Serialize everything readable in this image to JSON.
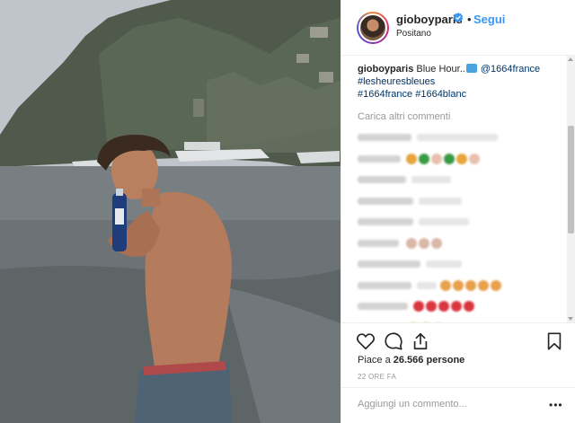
{
  "post": {
    "username": "gioboyparis",
    "follow_label": "Segui",
    "separator": "•",
    "location": "Positano",
    "verified": true,
    "accent_color": "#3897f0"
  },
  "caption": {
    "username": "gioboyparis",
    "text": "Blue Hour..",
    "mention": "@1664france",
    "hashtags_line1": "#lesheuresbleues",
    "hashtags_line2": "#1664france #1664blanc"
  },
  "comments": {
    "load_more": "Carica altri commenti"
  },
  "actions": {
    "like_icon": "heart-icon",
    "comment_icon": "comment-icon",
    "share_icon": "share-icon",
    "save_icon": "bookmark-icon",
    "likes_prefix": "Piace a",
    "likes_count": "26.566",
    "likes_suffix": "persone",
    "time_ago": "22 ORE FA"
  },
  "add_comment": {
    "placeholder": "Aggiungi un commento...",
    "more_options": "•••"
  }
}
